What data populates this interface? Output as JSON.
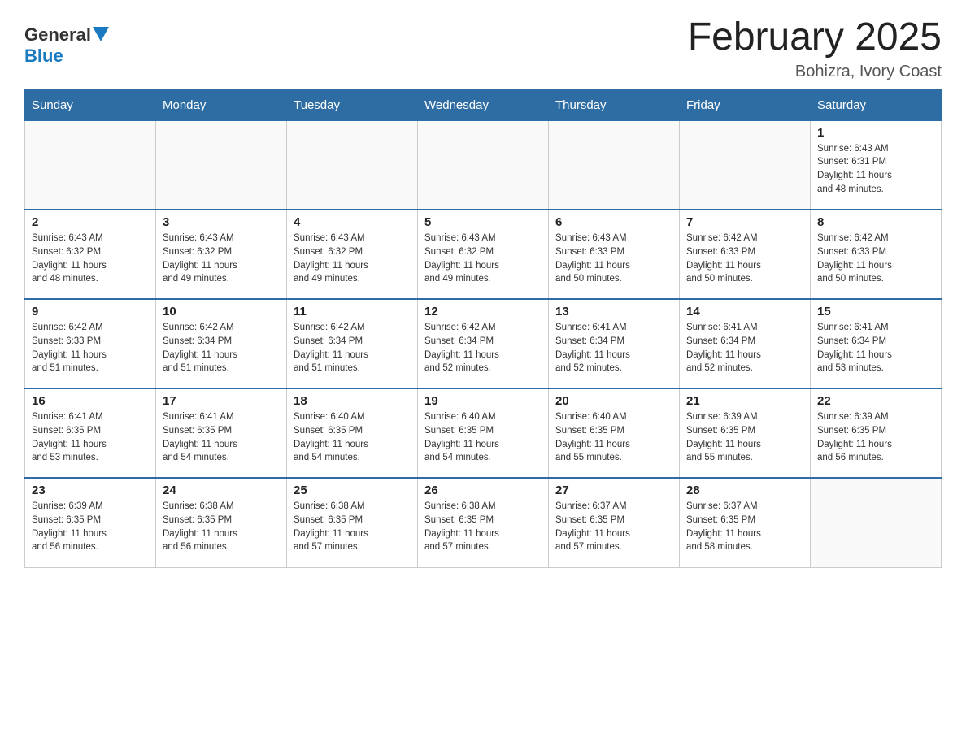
{
  "logo": {
    "general": "General",
    "blue": "Blue"
  },
  "header": {
    "month_title": "February 2025",
    "location": "Bohizra, Ivory Coast"
  },
  "weekdays": [
    "Sunday",
    "Monday",
    "Tuesday",
    "Wednesday",
    "Thursday",
    "Friday",
    "Saturday"
  ],
  "weeks": [
    [
      {
        "day": "",
        "info": ""
      },
      {
        "day": "",
        "info": ""
      },
      {
        "day": "",
        "info": ""
      },
      {
        "day": "",
        "info": ""
      },
      {
        "day": "",
        "info": ""
      },
      {
        "day": "",
        "info": ""
      },
      {
        "day": "1",
        "info": "Sunrise: 6:43 AM\nSunset: 6:31 PM\nDaylight: 11 hours\nand 48 minutes."
      }
    ],
    [
      {
        "day": "2",
        "info": "Sunrise: 6:43 AM\nSunset: 6:32 PM\nDaylight: 11 hours\nand 48 minutes."
      },
      {
        "day": "3",
        "info": "Sunrise: 6:43 AM\nSunset: 6:32 PM\nDaylight: 11 hours\nand 49 minutes."
      },
      {
        "day": "4",
        "info": "Sunrise: 6:43 AM\nSunset: 6:32 PM\nDaylight: 11 hours\nand 49 minutes."
      },
      {
        "day": "5",
        "info": "Sunrise: 6:43 AM\nSunset: 6:32 PM\nDaylight: 11 hours\nand 49 minutes."
      },
      {
        "day": "6",
        "info": "Sunrise: 6:43 AM\nSunset: 6:33 PM\nDaylight: 11 hours\nand 50 minutes."
      },
      {
        "day": "7",
        "info": "Sunrise: 6:42 AM\nSunset: 6:33 PM\nDaylight: 11 hours\nand 50 minutes."
      },
      {
        "day": "8",
        "info": "Sunrise: 6:42 AM\nSunset: 6:33 PM\nDaylight: 11 hours\nand 50 minutes."
      }
    ],
    [
      {
        "day": "9",
        "info": "Sunrise: 6:42 AM\nSunset: 6:33 PM\nDaylight: 11 hours\nand 51 minutes."
      },
      {
        "day": "10",
        "info": "Sunrise: 6:42 AM\nSunset: 6:34 PM\nDaylight: 11 hours\nand 51 minutes."
      },
      {
        "day": "11",
        "info": "Sunrise: 6:42 AM\nSunset: 6:34 PM\nDaylight: 11 hours\nand 51 minutes."
      },
      {
        "day": "12",
        "info": "Sunrise: 6:42 AM\nSunset: 6:34 PM\nDaylight: 11 hours\nand 52 minutes."
      },
      {
        "day": "13",
        "info": "Sunrise: 6:41 AM\nSunset: 6:34 PM\nDaylight: 11 hours\nand 52 minutes."
      },
      {
        "day": "14",
        "info": "Sunrise: 6:41 AM\nSunset: 6:34 PM\nDaylight: 11 hours\nand 52 minutes."
      },
      {
        "day": "15",
        "info": "Sunrise: 6:41 AM\nSunset: 6:34 PM\nDaylight: 11 hours\nand 53 minutes."
      }
    ],
    [
      {
        "day": "16",
        "info": "Sunrise: 6:41 AM\nSunset: 6:35 PM\nDaylight: 11 hours\nand 53 minutes."
      },
      {
        "day": "17",
        "info": "Sunrise: 6:41 AM\nSunset: 6:35 PM\nDaylight: 11 hours\nand 54 minutes."
      },
      {
        "day": "18",
        "info": "Sunrise: 6:40 AM\nSunset: 6:35 PM\nDaylight: 11 hours\nand 54 minutes."
      },
      {
        "day": "19",
        "info": "Sunrise: 6:40 AM\nSunset: 6:35 PM\nDaylight: 11 hours\nand 54 minutes."
      },
      {
        "day": "20",
        "info": "Sunrise: 6:40 AM\nSunset: 6:35 PM\nDaylight: 11 hours\nand 55 minutes."
      },
      {
        "day": "21",
        "info": "Sunrise: 6:39 AM\nSunset: 6:35 PM\nDaylight: 11 hours\nand 55 minutes."
      },
      {
        "day": "22",
        "info": "Sunrise: 6:39 AM\nSunset: 6:35 PM\nDaylight: 11 hours\nand 56 minutes."
      }
    ],
    [
      {
        "day": "23",
        "info": "Sunrise: 6:39 AM\nSunset: 6:35 PM\nDaylight: 11 hours\nand 56 minutes."
      },
      {
        "day": "24",
        "info": "Sunrise: 6:38 AM\nSunset: 6:35 PM\nDaylight: 11 hours\nand 56 minutes."
      },
      {
        "day": "25",
        "info": "Sunrise: 6:38 AM\nSunset: 6:35 PM\nDaylight: 11 hours\nand 57 minutes."
      },
      {
        "day": "26",
        "info": "Sunrise: 6:38 AM\nSunset: 6:35 PM\nDaylight: 11 hours\nand 57 minutes."
      },
      {
        "day": "27",
        "info": "Sunrise: 6:37 AM\nSunset: 6:35 PM\nDaylight: 11 hours\nand 57 minutes."
      },
      {
        "day": "28",
        "info": "Sunrise: 6:37 AM\nSunset: 6:35 PM\nDaylight: 11 hours\nand 58 minutes."
      },
      {
        "day": "",
        "info": ""
      }
    ]
  ]
}
